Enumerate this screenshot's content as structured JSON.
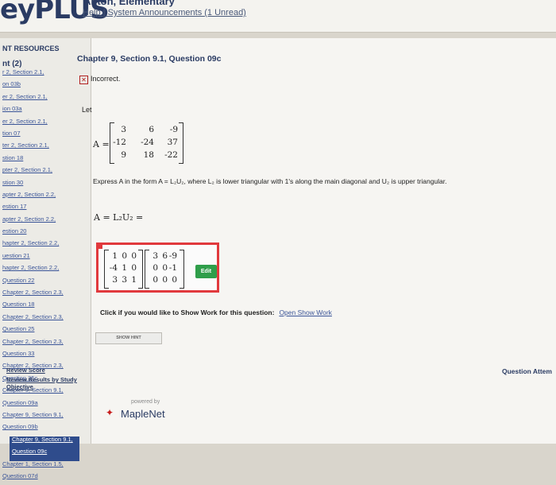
{
  "header": {
    "logo": "eyPLUS",
    "user_name": "Anton, Elementary",
    "links": "Help | System Announcements (1 Unread)"
  },
  "sidebar": {
    "title": "NT RESOURCES",
    "subtitle": "nt (2)",
    "items": [
      {
        "label": "r 2, Section 2.1,"
      },
      {
        "label": "on 03b"
      },
      {
        "label": "er 2, Section 2.1,"
      },
      {
        "label": "ion 03a"
      },
      {
        "label": "er 2, Section 2.1,"
      },
      {
        "label": "tion 07"
      },
      {
        "label": "ter 2, Section 2.1,"
      },
      {
        "label": "stion 18"
      },
      {
        "label": "pter 2, Section 2.1,"
      },
      {
        "label": "stion 30"
      },
      {
        "label": "apter 2, Section 2.2,"
      },
      {
        "label": "estion 17"
      },
      {
        "label": "apter 2, Section 2.2,"
      },
      {
        "label": "estion 20"
      },
      {
        "label": "hapter 2, Section 2.2,"
      },
      {
        "label": "uestion 21"
      },
      {
        "label": "hapter 2, Section 2.2,"
      },
      {
        "label": "Question 22"
      },
      {
        "label": "Chapter 2, Section 2.3,"
      },
      {
        "label": "Question 18"
      },
      {
        "label": "Chapter 2, Section 2.3,"
      },
      {
        "label": "Question 25"
      },
      {
        "label": "Chapter 2, Section 2.3,"
      },
      {
        "label": "Question 33"
      },
      {
        "label": "Chapter 2, Section 2.3,"
      },
      {
        "label": "Question 35c"
      },
      {
        "label": "Chapter 9, Section 9.1,"
      },
      {
        "label": "Question 09a"
      },
      {
        "label": "Chapter 9, Section 9.1,"
      },
      {
        "label": "Question 09b"
      },
      {
        "label": "Chapter 9, Section 9.1,"
      },
      {
        "label": "Question 09c"
      },
      {
        "label": "Chapter 1, Section 1.5,"
      },
      {
        "label": "Question 07d"
      }
    ],
    "active_index": 30,
    "bottom_links": [
      "Review Score",
      "Review Results by Study Objective"
    ]
  },
  "question": {
    "title": "Chapter 9, Section 9.1, Question 09c",
    "status": "Incorrect.",
    "let_label": "Let",
    "matrix_label": "A =",
    "matrix_A": [
      [
        "3",
        "6",
        "-9"
      ],
      [
        "-12",
        "-24",
        "37"
      ],
      [
        "9",
        "18",
        "-22"
      ]
    ],
    "instruction": "Express A in the form A = L₂U₂, where L₂ is lower triangular with 1's along the main diagonal and U₂ is upper triangular.",
    "answer_label": "A = L₂U₂ =",
    "L_matrix": [
      [
        "1",
        "0",
        "0"
      ],
      [
        "-4",
        "1",
        "0"
      ],
      [
        "3",
        "3",
        "1"
      ]
    ],
    "U_matrix": [
      [
        "3",
        "6",
        "-9"
      ],
      [
        "0",
        "0",
        "-1"
      ],
      [
        "0",
        "0",
        "0"
      ]
    ],
    "edit_label": "Edit",
    "show_work_text": "Click if you would like to Show Work for this question:",
    "show_work_link": "Open Show Work",
    "hint_label": "SHOW HINT",
    "attempts_label": "Question Attem"
  },
  "footer": {
    "powered_by": "powered by",
    "brand": "MapleNet"
  }
}
